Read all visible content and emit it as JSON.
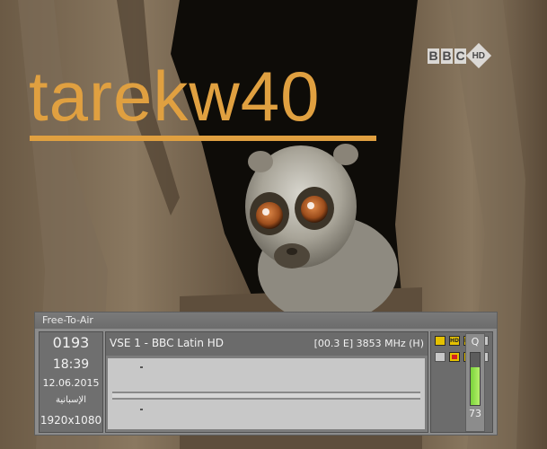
{
  "overlay": {
    "watermark_text": "tarekw40",
    "broadcaster_letters": [
      "B",
      "B",
      "C"
    ],
    "broadcaster_badge": "HD"
  },
  "infobar": {
    "ca_status": "Free-To-Air",
    "channel_number": "0193",
    "time": "18:39",
    "date": "12.06.2015",
    "language": "الإسبانية",
    "resolution": "1920x1080",
    "channel_name": "VSE 1 - BBC Latin HD",
    "frequency": "[00.3 E] 3853 MHz (H)",
    "icons": [
      {
        "name": "tv-icon",
        "label": "",
        "state": "on"
      },
      {
        "name": "hd-icon",
        "label": "HD",
        "state": "on"
      },
      {
        "name": "dolby-icon",
        "label": "DD",
        "state": "on"
      },
      {
        "name": "subtitle-icon",
        "label": "",
        "state": "off"
      },
      {
        "name": "teletext-icon",
        "label": "",
        "state": "off"
      },
      {
        "name": "scrambled-icon",
        "label": "",
        "state": "red"
      },
      {
        "name": "network-icon",
        "label": "",
        "state": "on"
      },
      {
        "name": "record-icon",
        "label": "",
        "state": "off"
      }
    ]
  },
  "signal": {
    "label": "Q",
    "value": "73",
    "level_percent": 73
  },
  "colors": {
    "watermark": "#e0a040",
    "icon_active": "#e5c100",
    "signal_fill": "#8fdc46"
  }
}
